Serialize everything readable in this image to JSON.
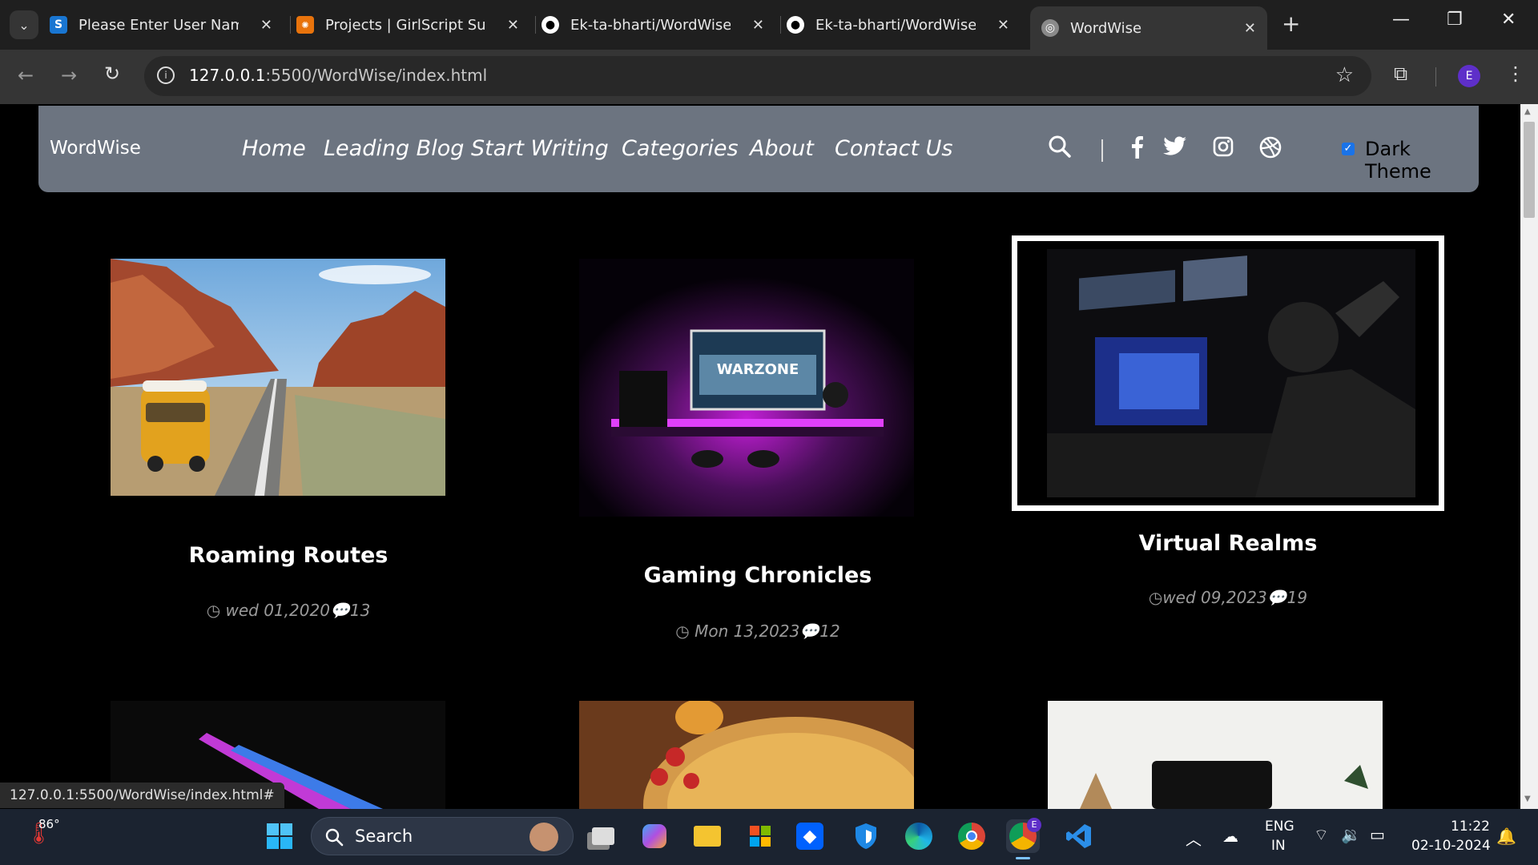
{
  "browser": {
    "tabs": [
      {
        "title": "Please Enter User Name &",
        "favicon": "S"
      },
      {
        "title": "Projects | GirlScript Summ",
        "favicon": "gs"
      },
      {
        "title": "Ek-ta-bharti/WordWise: E",
        "favicon": "github"
      },
      {
        "title": "Ek-ta-bharti/WordWise: E",
        "favicon": "github"
      },
      {
        "title": "WordWise",
        "favicon": "globe"
      }
    ],
    "url_host": "127.0.0.1",
    "url_rest": ":5500/WordWise/index.html",
    "profile_initial": "E"
  },
  "site": {
    "brand": "WordWise",
    "menu": [
      "Home",
      "Leading Blog",
      "Start Writing",
      "Categories",
      "About",
      "Contact Us"
    ],
    "theme_label": "Dark Theme",
    "cards": [
      {
        "title": "Roaming Routes",
        "date": "wed 01,2020",
        "comments": "13"
      },
      {
        "title": "Gaming Chronicles",
        "date": "Mon 13,2023",
        "comments": "12"
      },
      {
        "title": "Virtual Realms",
        "date": "wed 09,2023",
        "comments": "19"
      }
    ]
  },
  "status_url": "127.0.0.1:5500/WordWise/index.html#",
  "taskbar": {
    "temp": "86°",
    "search": "Search",
    "lang1": "ENG",
    "lang2": "IN",
    "time": "11:22",
    "date": "02-10-2024"
  },
  "colors": {
    "navbar": "#6c7480",
    "accent": "#1a73e8",
    "page_bg": "#000000"
  }
}
